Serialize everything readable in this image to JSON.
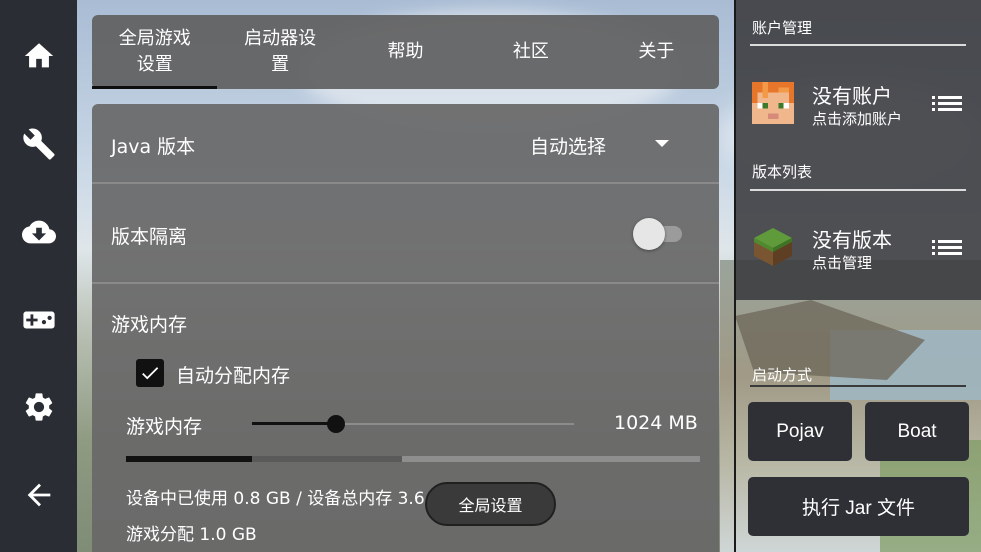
{
  "nav": {
    "items": [
      {
        "icon": "home-icon"
      },
      {
        "icon": "wrench-icon"
      },
      {
        "icon": "cloud-download-icon"
      },
      {
        "icon": "gamepad-icon"
      },
      {
        "icon": "gear-icon"
      },
      {
        "icon": "back-arrow-icon"
      }
    ]
  },
  "tabs": [
    {
      "label": "全局游戏设置",
      "active": true
    },
    {
      "label": "启动器设置",
      "active": false
    },
    {
      "label": "帮助",
      "active": false
    },
    {
      "label": "社区",
      "active": false
    },
    {
      "label": "关于",
      "active": false
    }
  ],
  "settings": {
    "java": {
      "label": "Java 版本",
      "value": "自动选择"
    },
    "isolation": {
      "label": "版本隔离",
      "enabled": false
    },
    "memory": {
      "section_label": "游戏内存",
      "auto_alloc_label": "自动分配内存",
      "auto_alloc_checked": true,
      "slider_label": "游戏内存",
      "slider_value": "1024 MB",
      "slider_fraction": 0.26,
      "bar_used_fraction": 0.22,
      "bar_alloc_fraction": 0.48,
      "used_text": "设备中已使用 0.8 GB / 设备总内存 3.6 GB",
      "alloc_text": "游戏分配 1.0 GB"
    }
  },
  "toast": {
    "label": "全局设置"
  },
  "right": {
    "account_section": "账户管理",
    "account_title": "没有账户",
    "account_sub": "点击添加账户",
    "version_section": "版本列表",
    "version_title": "没有版本",
    "version_sub": "点击管理",
    "launch_section": "启动方式",
    "pojav_label": "Pojav",
    "boat_label": "Boat",
    "jar_label": "执行 Jar 文件"
  }
}
